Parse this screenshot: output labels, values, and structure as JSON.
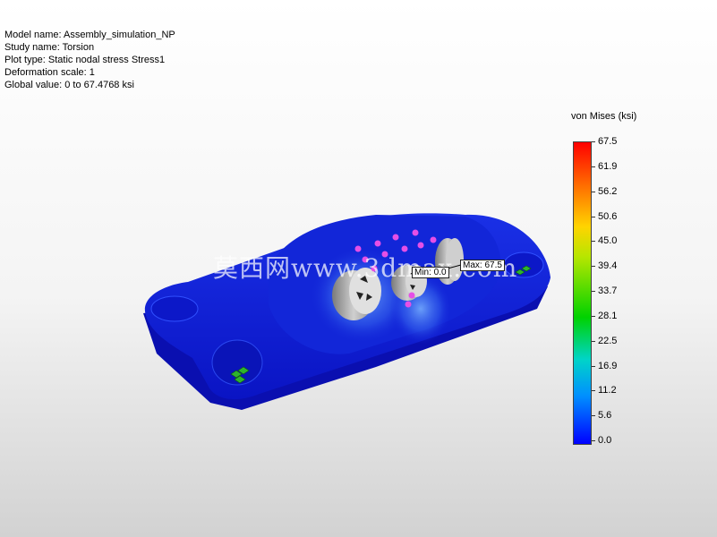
{
  "plot_info": {
    "model_name": "Model name: Assembly_simulation_NP",
    "study_name": "Study name: Torsion",
    "plot_type": "Plot type: Static nodal stress Stress1",
    "deformation_scale": "Deformation scale: 1",
    "global_value": "Global value: 0 to 67.4768 ksi"
  },
  "legend": {
    "title": "von Mises (ksi)",
    "ticks": [
      "67.5",
      "61.9",
      "56.2",
      "50.6",
      "45.0",
      "39.4",
      "33.7",
      "28.1",
      "22.5",
      "16.9",
      "11.2",
      "5.6",
      "0.0"
    ],
    "colors": {
      "max": "#ff0000",
      "high": "#ff7a00",
      "mid_high": "#ffd400",
      "mid": "#00d200",
      "mid_low": "#00d4c8",
      "low": "#0090ff",
      "min": "#0000ff"
    }
  },
  "annotations": {
    "max_label": "Max: 67.5",
    "min_label": "Min: 0.0"
  },
  "watermark": {
    "text": "莫西网www.3dmax.com"
  },
  "model_colors": {
    "body": "#1020d8",
    "stress_light": "#4a8cff",
    "bearing": "#a8a8a8",
    "fixture": "#e64fe6",
    "hole_fixture": "#2eb42e"
  }
}
